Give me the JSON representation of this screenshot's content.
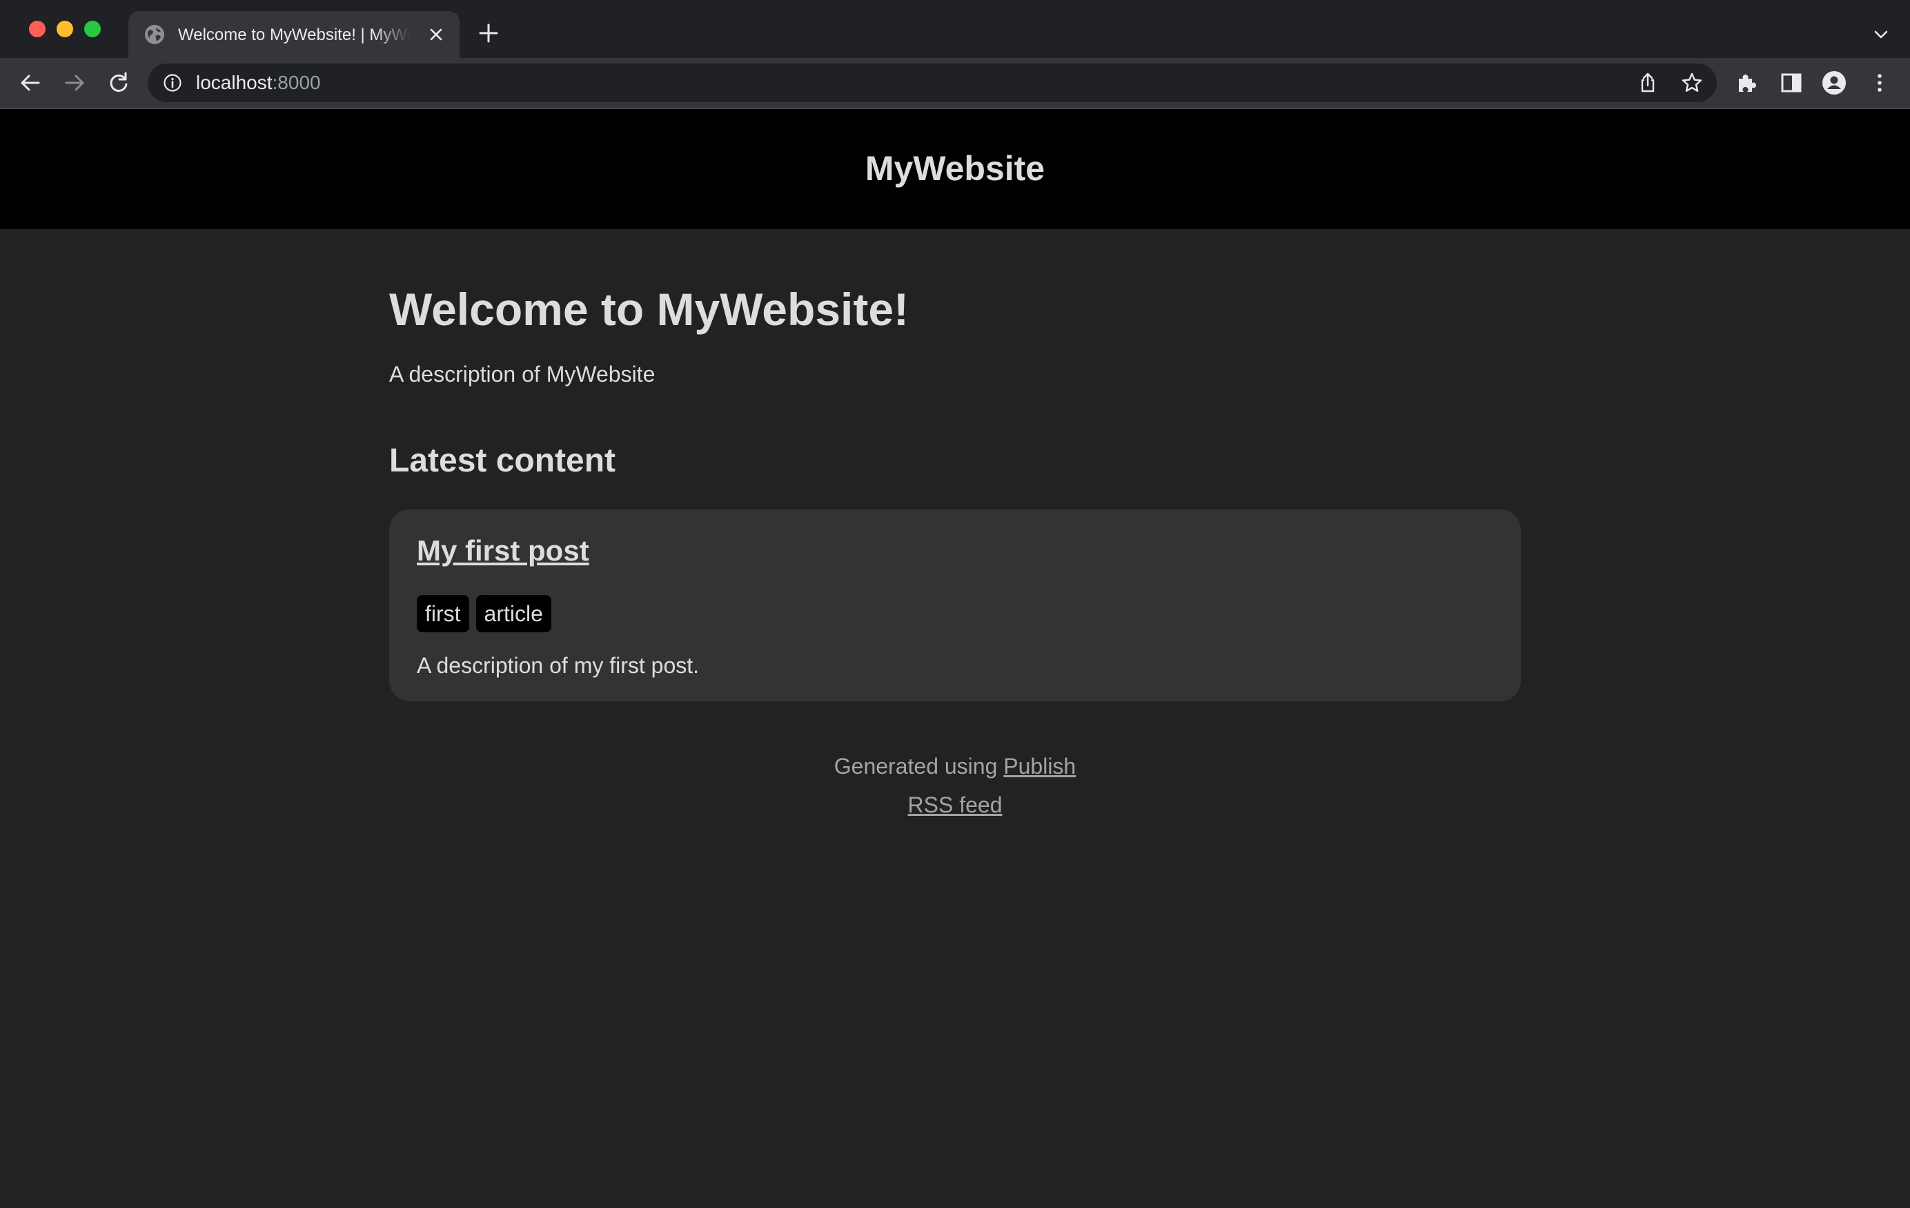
{
  "browser": {
    "tab": {
      "title": "Welcome to MyWebsite! | MyWebsite",
      "favicon": "globe-icon"
    },
    "address": {
      "host": "localhost",
      "port": ":8000"
    },
    "icons": [
      "back-arrow-icon",
      "forward-arrow-icon",
      "reload-icon",
      "info-icon",
      "share-icon",
      "star-icon",
      "extensions-icon",
      "side-panel-icon",
      "profile-icon",
      "menu-icon",
      "close-icon",
      "plus-icon",
      "chevron-down-icon"
    ]
  },
  "site": {
    "header_title": "MyWebsite",
    "welcome_heading": "Welcome to MyWebsite!",
    "description": "A description of MyWebsite",
    "latest_heading": "Latest content"
  },
  "posts": [
    {
      "title": "My first post",
      "tags": [
        "first",
        "article"
      ],
      "description": "A description of my first post."
    }
  ],
  "footer": {
    "generated_prefix": "Generated using ",
    "publish_link": "Publish",
    "rss_link": "RSS feed"
  },
  "colors": {
    "page_background": "#222222",
    "header_background": "#000000",
    "card_background": "#333333",
    "text": "#dddddd",
    "footer_text": "#a4a4a4"
  }
}
